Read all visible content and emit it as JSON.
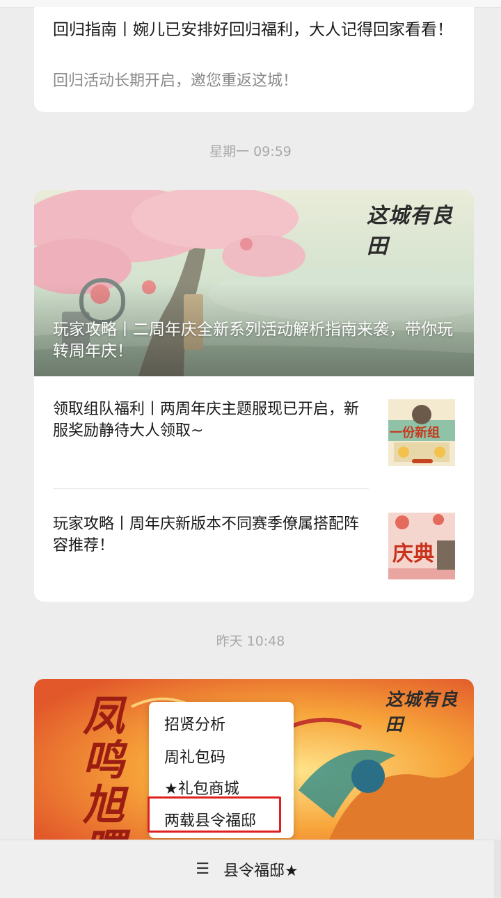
{
  "article_top": {
    "title": "回归指南丨婉儿已安排好回归福利，大人记得回家看看！",
    "desc": "回归活动长期开启，邀您重返这城！"
  },
  "timestamps": [
    "星期一 09:59",
    "昨天 10:48"
  ],
  "group_monday": {
    "hero": {
      "title": "玩家攻略丨二周年庆全新系列活动解析指南来袭，带你玩转周年庆！",
      "logo": "这城有良田"
    },
    "items": [
      {
        "title": "领取组队福利丨两周年庆主题服现已开启，新服奖励静待大人领取~",
        "thumb_text": "一份新组"
      },
      {
        "title": "玩家攻略丨周年庆新版本不同赛季僚属搭配阵容推荐！",
        "thumb_text": "庆典"
      }
    ]
  },
  "group_yesterday": {
    "hero": {
      "logo": "这城有良田",
      "art_text": "凤鸣旭曙"
    }
  },
  "popup_menu": {
    "items": [
      "招贤分析",
      "周礼包码",
      "★礼包商城",
      "两载县令福邸"
    ],
    "highlighted_index": 3,
    "highlight_color": "#e02020"
  },
  "bottom_menu": {
    "icon": "menu-icon",
    "icon_glyph": "☰",
    "label": "县令福邸★"
  }
}
